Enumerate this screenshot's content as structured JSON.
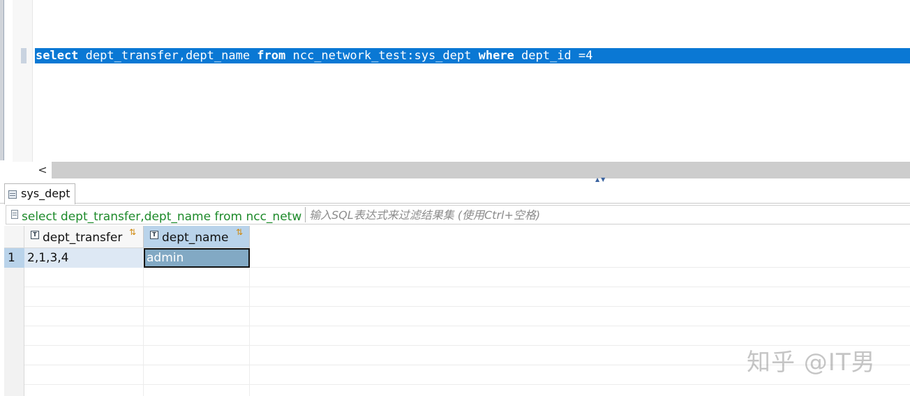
{
  "editor": {
    "sql_tokens": [
      {
        "text": "select",
        "keyword": true
      },
      {
        "text": " dept_transfer,dept_name ",
        "keyword": false
      },
      {
        "text": "from",
        "keyword": true
      },
      {
        "text": " ncc_network_test:sys_dept ",
        "keyword": false
      },
      {
        "text": "where",
        "keyword": true
      },
      {
        "text": " dept_id =4",
        "keyword": false
      }
    ]
  },
  "scrollbar": {
    "left_arrow": "<"
  },
  "results": {
    "tab_label": "sys_dept",
    "filter": {
      "query_preview": "select dept_transfer,dept_name from ncc_netw",
      "placeholder": "输入SQL表达式来过滤结果集 (使用Ctrl+空格)"
    },
    "columns": [
      {
        "label": "dept_transfer",
        "type_icon": "T"
      },
      {
        "label": "dept_name",
        "type_icon": "T"
      }
    ],
    "rows": [
      {
        "num": "1",
        "cells": [
          "2,1,3,4",
          "admin"
        ]
      }
    ]
  },
  "watermark": "知乎 @IT男",
  "colors": {
    "selection": "#0a78d4",
    "filter_text": "#1d8a2a",
    "selected_header": "#b9d3ea",
    "selected_cell": "#82a9c4"
  }
}
